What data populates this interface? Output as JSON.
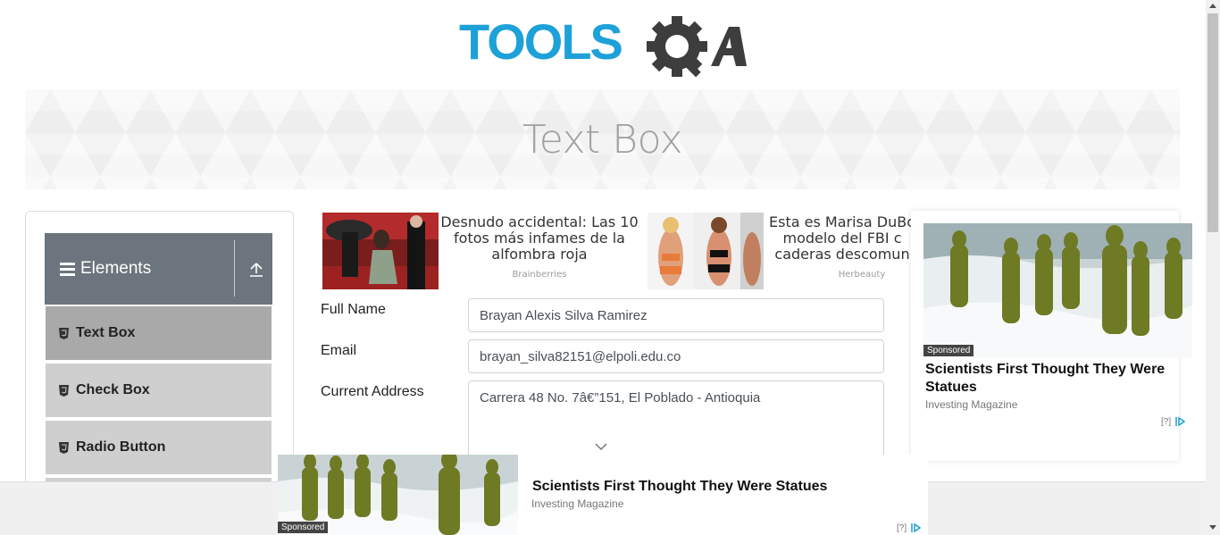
{
  "logo": {
    "text_part1": "TOOLS",
    "text_part2": "QA"
  },
  "page": {
    "title": "Text Box"
  },
  "sidebar": {
    "group_title": "Elements",
    "items": [
      {
        "label": "Text Box",
        "active": true
      },
      {
        "label": "Check Box",
        "active": false
      },
      {
        "label": "Radio Button",
        "active": false
      }
    ]
  },
  "ads": [
    {
      "text": "Desnudo accidental: Las 10 fotos más infames de la alfombra roja",
      "source": "Brainberries"
    },
    {
      "text": "Esta es Marisa DuBo modelo del FBI c caderas descomun",
      "source": "Herbeauty"
    }
  ],
  "form": {
    "full_name": {
      "label": "Full Name",
      "value": "Brayan Alexis Silva Ramirez"
    },
    "email": {
      "label": "Email",
      "value": "brayan_silva82151@elpoli.edu.co"
    },
    "current_address": {
      "label": "Current Address",
      "value": "Carrera 48 No. 7â€”151, El Poblado - Antioquia"
    }
  },
  "right_ad": {
    "badge": "Sponsored",
    "title": "Scientists First Thought They Were Statues",
    "source": "Investing Magazine",
    "adchoice": "[?]"
  },
  "bottom_ad": {
    "badge": "Sponsored",
    "title": "Scientists First Thought They Were Statues",
    "source": "Investing Magazine",
    "adchoice": "[?]"
  },
  "colors": {
    "logo_blue": "#1da1d8",
    "logo_dark": "#404040",
    "sidebar_header": "#6c757d",
    "active_item": "#a9a9a9",
    "item": "#cfcfcf"
  }
}
